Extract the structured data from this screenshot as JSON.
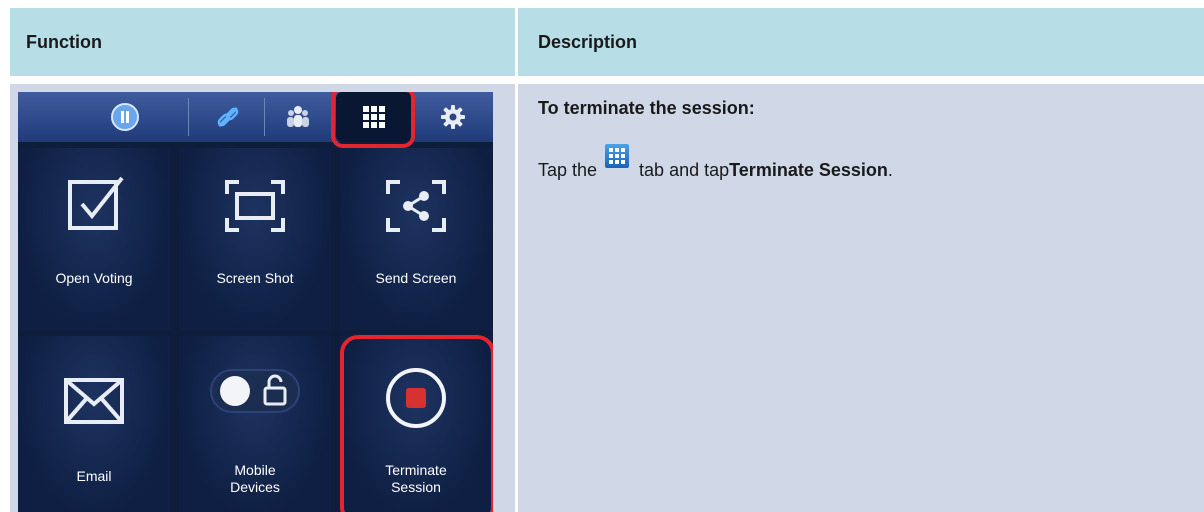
{
  "header": {
    "function": "Function",
    "description": "Description"
  },
  "description": {
    "title": "To terminate the session:",
    "line_start": "Tap the",
    "line_mid": "tab and tap",
    "line_bold": "Terminate Session",
    "line_end": "."
  },
  "app": {
    "tabs": [
      "pause-icon",
      "link-icon",
      "group-icon",
      "grid-icon",
      "settings-icon"
    ],
    "active_tab": "grid-icon",
    "tiles": [
      {
        "label": "Open Voting",
        "icon": "checkbox-icon"
      },
      {
        "label": "Screen Shot",
        "icon": "screenshot-icon"
      },
      {
        "label": "Send Screen",
        "icon": "share-icon"
      },
      {
        "label": "Email",
        "icon": "envelope-icon"
      },
      {
        "label": "Mobile Devices",
        "label_lines": [
          "Mobile",
          "Devices"
        ],
        "icon": "toggle-lock-icon"
      },
      {
        "label": "Terminate Session",
        "label_lines": [
          "Terminate",
          "Session"
        ],
        "icon": "stop-icon"
      }
    ],
    "highlight_color": "#e2262f"
  }
}
